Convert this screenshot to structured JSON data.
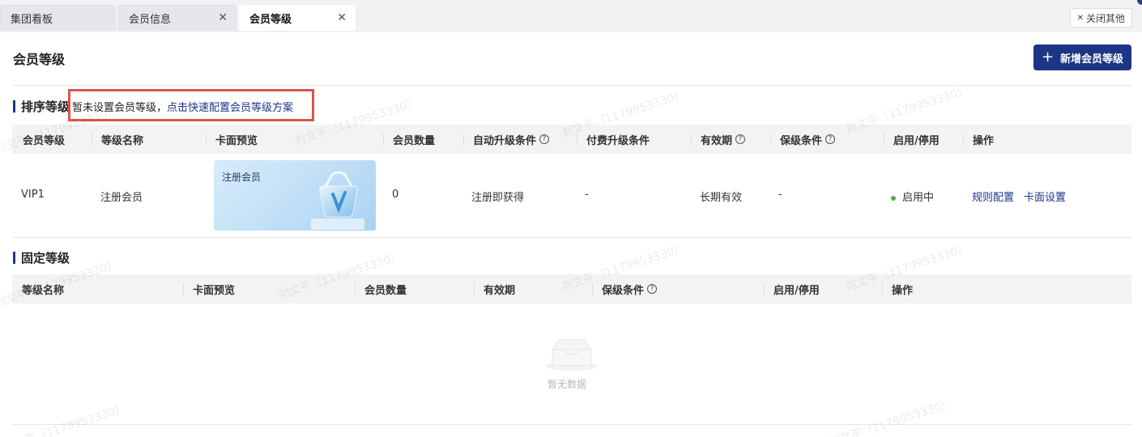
{
  "tabs": [
    {
      "label": "集团看板",
      "closable": false,
      "active": false
    },
    {
      "label": "会员信息",
      "closable": true,
      "active": false
    },
    {
      "label": "会员等级",
      "closable": true,
      "active": true
    }
  ],
  "tabbar": {
    "close_others": "关闭其他",
    "close_glyph": "✕"
  },
  "page": {
    "title": "会员等级",
    "add_button": "新增会员等级",
    "add_icon": "plus-icon"
  },
  "sorted": {
    "title": "排序等级",
    "notice_text": "暂未设置会员等级，",
    "notice_link": "点击快速配置会员等级方案",
    "columns": [
      "会员等级",
      "等级名称",
      "卡面预览",
      "会员数量",
      "自动升级条件",
      "付费升级条件",
      "有效期",
      "保级条件",
      "启用/停用",
      "操作"
    ],
    "rows": [
      {
        "level": "VIP1",
        "name": "注册会员",
        "card_title": "注册会员",
        "count": "0",
        "auto_upgrade": "注册即获得",
        "paid_upgrade": "-",
        "validity": "长期有效",
        "retain": "-",
        "status": "启用中",
        "ops": [
          "规则配置",
          "卡面设置"
        ]
      }
    ]
  },
  "fixed": {
    "title": "固定等级",
    "columns": [
      "等级名称",
      "卡面预览",
      "会员数量",
      "有效期",
      "保级条件",
      "启用/停用",
      "操作"
    ],
    "empty_text": "暂无数据"
  },
  "watermark": "刘文平（1179953330）",
  "colors": {
    "primary": "#1d3585",
    "highlight": "#e0524c",
    "status_on": "#4caf50"
  }
}
